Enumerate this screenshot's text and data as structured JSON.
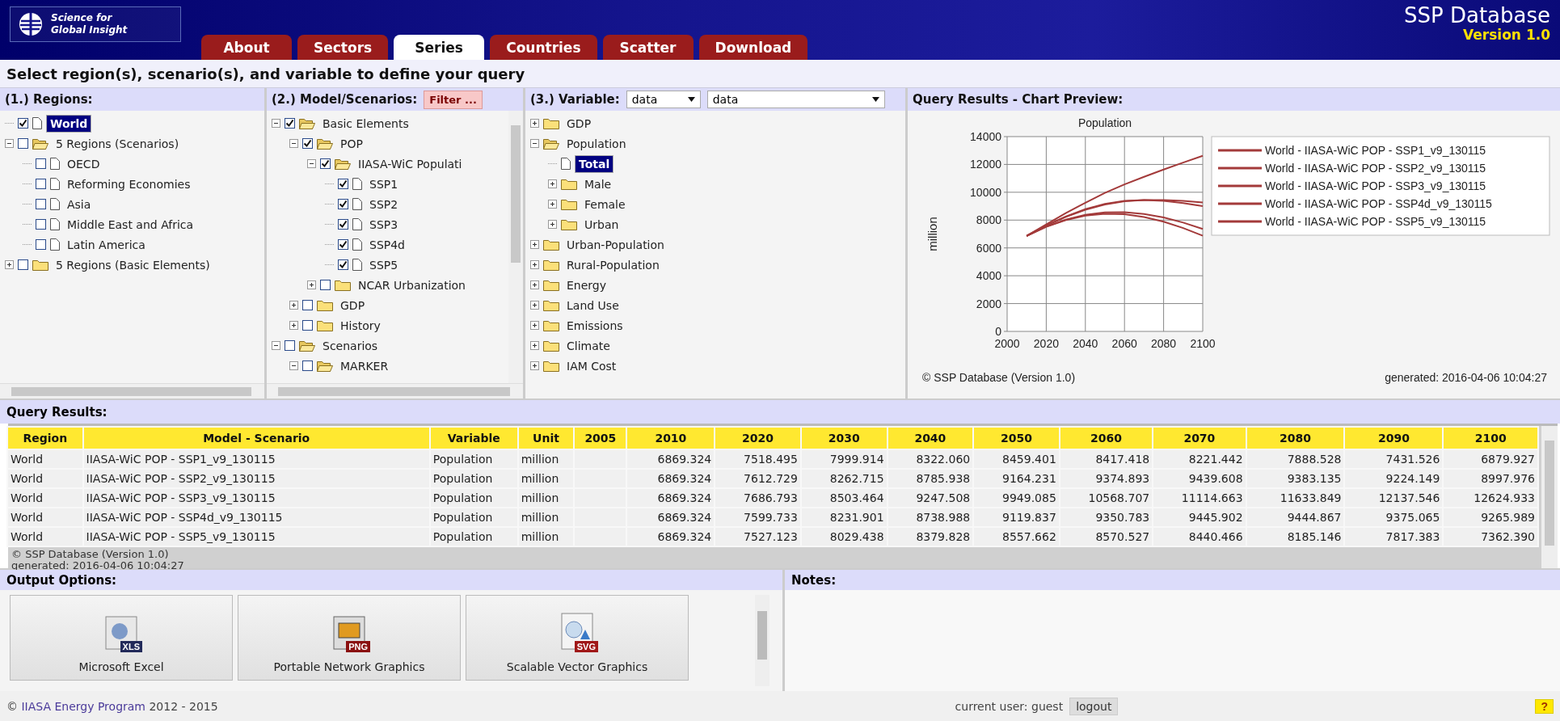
{
  "header": {
    "logo_lines": [
      "Science for",
      "Global Insight"
    ],
    "app_title": "SSP Database",
    "version": "Version 1.0"
  },
  "tabs": [
    {
      "label": "About",
      "selected": false
    },
    {
      "label": "Sectors",
      "selected": false
    },
    {
      "label": "Series",
      "selected": true
    },
    {
      "label": "Countries",
      "selected": false
    },
    {
      "label": "Scatter",
      "selected": false
    },
    {
      "label": "Download",
      "selected": false
    }
  ],
  "instruction": "Select region(s), scenario(s), and variable to define your query",
  "regions": {
    "title": "(1.) Regions:",
    "items": [
      {
        "kind": "item",
        "label": "World",
        "checked": true,
        "selected": true
      },
      {
        "kind": "folder",
        "label": "5 Regions (Scenarios)",
        "checked": false,
        "selected": false,
        "expanded": true,
        "children": [
          {
            "kind": "item",
            "label": "OECD",
            "checked": false,
            "selected": false
          },
          {
            "kind": "item",
            "label": "Reforming Economies",
            "checked": false,
            "selected": false
          },
          {
            "kind": "item",
            "label": "Asia",
            "checked": false,
            "selected": false
          },
          {
            "kind": "item",
            "label": "Middle East and Africa",
            "checked": false,
            "selected": false
          },
          {
            "kind": "item",
            "label": "Latin America",
            "checked": false,
            "selected": false
          }
        ]
      },
      {
        "kind": "folder",
        "label": "5 Regions (Basic Elements)",
        "checked": false,
        "selected": false,
        "expanded": false
      }
    ]
  },
  "models": {
    "title": "(2.) Model/Scenarios:",
    "filter_button": "Filter ...",
    "items": [
      {
        "kind": "folder",
        "label": "Basic Elements",
        "checked": true,
        "expanded": true,
        "children": [
          {
            "kind": "folder",
            "label": "POP",
            "checked": true,
            "expanded": true,
            "children": [
              {
                "kind": "folder",
                "label": "IIASA-WiC Populati",
                "checked": true,
                "expanded": true,
                "children": [
                  {
                    "kind": "item",
                    "label": "SSP1",
                    "checked": true
                  },
                  {
                    "kind": "item",
                    "label": "SSP2",
                    "checked": true
                  },
                  {
                    "kind": "item",
                    "label": "SSP3",
                    "checked": true
                  },
                  {
                    "kind": "item",
                    "label": "SSP4d",
                    "checked": true
                  },
                  {
                    "kind": "item",
                    "label": "SSP5",
                    "checked": true
                  }
                ]
              },
              {
                "kind": "folder",
                "label": "NCAR Urbanization",
                "checked": false,
                "expanded": false
              }
            ]
          },
          {
            "kind": "folder",
            "label": "GDP",
            "checked": false,
            "expanded": false
          },
          {
            "kind": "folder",
            "label": "History",
            "checked": false,
            "expanded": false
          }
        ]
      },
      {
        "kind": "folder",
        "label": "Scenarios",
        "checked": false,
        "expanded": true,
        "children": [
          {
            "kind": "folder",
            "label": "MARKER",
            "checked": false,
            "expanded": true
          }
        ]
      }
    ]
  },
  "variable": {
    "title": "(3.) Variable:",
    "selects": [
      "data",
      "data"
    ],
    "items": [
      {
        "kind": "folder",
        "label": "GDP",
        "selected": false,
        "expanded": false
      },
      {
        "kind": "folder",
        "label": "Population",
        "selected": false,
        "expanded": true,
        "children": [
          {
            "kind": "item",
            "label": "Total",
            "selected": true
          },
          {
            "kind": "folder",
            "label": "Male",
            "selected": false,
            "expanded": false
          },
          {
            "kind": "folder",
            "label": "Female",
            "selected": false,
            "expanded": false
          },
          {
            "kind": "folder",
            "label": "Urban",
            "selected": false,
            "expanded": false
          }
        ]
      },
      {
        "kind": "folder",
        "label": "Urban-Population",
        "selected": false,
        "expanded": false
      },
      {
        "kind": "folder",
        "label": "Rural-Population",
        "selected": false,
        "expanded": false
      },
      {
        "kind": "folder",
        "label": "Energy",
        "selected": false,
        "expanded": false
      },
      {
        "kind": "folder",
        "label": "Land Use",
        "selected": false,
        "expanded": false
      },
      {
        "kind": "folder",
        "label": "Emissions",
        "selected": false,
        "expanded": false
      },
      {
        "kind": "folder",
        "label": "Climate",
        "selected": false,
        "expanded": false
      },
      {
        "kind": "folder",
        "label": "IAM Cost",
        "selected": false,
        "expanded": false
      }
    ]
  },
  "chart": {
    "title": "Query Results - Chart Preview:",
    "copyright": "© SSP Database (Version 1.0)",
    "generated": "generated: 2016-04-06 10:04:27",
    "chart_data": {
      "type": "line",
      "grid": true,
      "legend": true,
      "title": "Population",
      "ylabel": "million",
      "x": [
        2010,
        2020,
        2030,
        2040,
        2050,
        2060,
        2070,
        2080,
        2090,
        2100
      ],
      "xlim": [
        2000,
        2100
      ],
      "ylim": [
        0,
        14000
      ],
      "xticks": [
        2000,
        2020,
        2040,
        2060,
        2080,
        2100
      ],
      "yticks": [
        0,
        2000,
        4000,
        6000,
        8000,
        10000,
        12000,
        14000
      ],
      "series": [
        {
          "name": "World - IIASA-WiC POP - SSP1_v9_130115",
          "color": "#a33a3a",
          "values": [
            6869,
            7518,
            8000,
            8322,
            8459,
            8417,
            8221,
            7889,
            7432,
            6880
          ]
        },
        {
          "name": "World - IIASA-WiC POP - SSP2_v9_130115",
          "color": "#a33a3a",
          "values": [
            6869,
            7613,
            8263,
            8786,
            9164,
            9375,
            9440,
            9383,
            9224,
            8998
          ]
        },
        {
          "name": "World - IIASA-WiC POP - SSP3_v9_130115",
          "color": "#a33a3a",
          "values": [
            6869,
            7687,
            8503,
            9248,
            9949,
            10569,
            11115,
            11634,
            12138,
            12625
          ]
        },
        {
          "name": "World - IIASA-WiC POP - SSP4d_v9_130115",
          "color": "#a33a3a",
          "values": [
            6869,
            7600,
            8232,
            8739,
            9120,
            9351,
            9446,
            9445,
            9375,
            9266
          ]
        },
        {
          "name": "World - IIASA-WiC POP - SSP5_v9_130115",
          "color": "#a33a3a",
          "values": [
            6869,
            7527,
            8029,
            8380,
            8558,
            8571,
            8440,
            8185,
            7817,
            7362
          ]
        }
      ]
    }
  },
  "results": {
    "title": "Query Results:",
    "columns": [
      "Region",
      "Model - Scenario",
      "Variable",
      "Unit",
      "2005",
      "2010",
      "2020",
      "2030",
      "2040",
      "2050",
      "2060",
      "2070",
      "2080",
      "2090",
      "2100"
    ],
    "rows": [
      [
        "World",
        "IIASA-WiC POP - SSP1_v9_130115",
        "Population",
        "million",
        "",
        "6869.324",
        "7518.495",
        "7999.914",
        "8322.060",
        "8459.401",
        "8417.418",
        "8221.442",
        "7888.528",
        "7431.526",
        "6879.927"
      ],
      [
        "World",
        "IIASA-WiC POP - SSP2_v9_130115",
        "Population",
        "million",
        "",
        "6869.324",
        "7612.729",
        "8262.715",
        "8785.938",
        "9164.231",
        "9374.893",
        "9439.608",
        "9383.135",
        "9224.149",
        "8997.976"
      ],
      [
        "World",
        "IIASA-WiC POP - SSP3_v9_130115",
        "Population",
        "million",
        "",
        "6869.324",
        "7686.793",
        "8503.464",
        "9247.508",
        "9949.085",
        "10568.707",
        "11114.663",
        "11633.849",
        "12137.546",
        "12624.933"
      ],
      [
        "World",
        "IIASA-WiC POP - SSP4d_v9_130115",
        "Population",
        "million",
        "",
        "6869.324",
        "7599.733",
        "8231.901",
        "8738.988",
        "9119.837",
        "9350.783",
        "9445.902",
        "9444.867",
        "9375.065",
        "9265.989"
      ],
      [
        "World",
        "IIASA-WiC POP - SSP5_v9_130115",
        "Population",
        "million",
        "",
        "6869.324",
        "7527.123",
        "8029.438",
        "8379.828",
        "8557.662",
        "8570.527",
        "8440.466",
        "8185.146",
        "7817.383",
        "7362.390"
      ]
    ],
    "copyright": "© SSP Database (Version 1.0)",
    "generated": "generated: 2016-04-06 10:04:27"
  },
  "output": {
    "title": "Output Options:",
    "buttons": [
      {
        "label": "Microsoft Excel",
        "badge": "XLS"
      },
      {
        "label": "Portable Network Graphics",
        "badge": "PNG"
      },
      {
        "label": "Scalable Vector Graphics",
        "badge": "SVG"
      }
    ]
  },
  "notes": {
    "title": "Notes:"
  },
  "footer": {
    "prefix": "©",
    "link": "IIASA Energy Program",
    "suffix": "2012 - 2015",
    "user": "current user: guest",
    "logout": "logout",
    "help": "?"
  }
}
